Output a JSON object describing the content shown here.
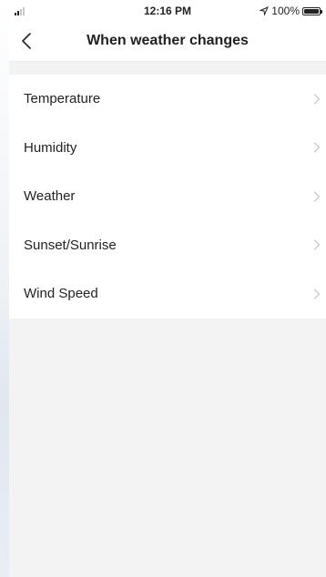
{
  "status_bar": {
    "time": "12:16 PM",
    "battery": "100%",
    "battery_level": 1.0
  },
  "header": {
    "title": "When weather changes",
    "back_icon": "chevron-left-icon"
  },
  "conditions": {
    "items": [
      {
        "label": "Temperature",
        "icon": "chevron-right-icon"
      },
      {
        "label": "Humidity",
        "icon": "chevron-right-icon"
      },
      {
        "label": "Weather",
        "icon": "chevron-right-icon"
      },
      {
        "label": "Sunset/Sunrise",
        "icon": "chevron-right-icon"
      },
      {
        "label": "Wind Speed",
        "icon": "chevron-right-icon"
      }
    ]
  },
  "colors": {
    "background": "#f3f3f3",
    "surface": "#ffffff",
    "text": "#222222",
    "chevron": "#c4c4c4"
  }
}
